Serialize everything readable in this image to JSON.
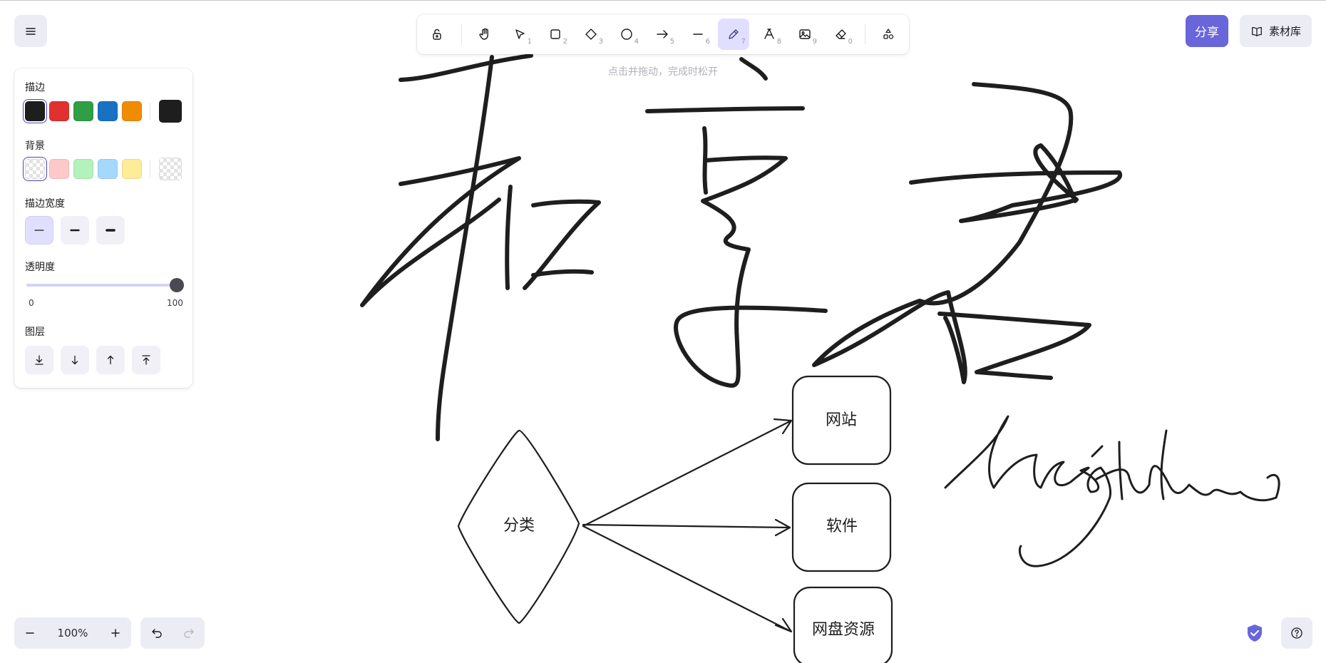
{
  "toolbar": {
    "tools": [
      {
        "name": "lock",
        "key": ""
      },
      {
        "name": "hand",
        "key": ""
      },
      {
        "name": "selection",
        "key": "1"
      },
      {
        "name": "rectangle",
        "key": "2"
      },
      {
        "name": "diamond",
        "key": "3"
      },
      {
        "name": "ellipse",
        "key": "4"
      },
      {
        "name": "arrow",
        "key": "5"
      },
      {
        "name": "line",
        "key": "6"
      },
      {
        "name": "freedraw",
        "key": "7",
        "active": true
      },
      {
        "name": "text",
        "key": "8"
      },
      {
        "name": "image",
        "key": "9"
      },
      {
        "name": "eraser",
        "key": "0"
      },
      {
        "name": "more-shapes",
        "key": ""
      }
    ],
    "hint": "点击并拖动，完成时松开"
  },
  "header": {
    "share_label": "分享",
    "library_label": "素材库"
  },
  "panel": {
    "stroke_title": "描边",
    "stroke_colors": [
      "#1e1e1e",
      "#e03131",
      "#2f9e44",
      "#1971c2",
      "#f08c00"
    ],
    "stroke_current": "#1e1e1e",
    "background_title": "背景",
    "background_colors": [
      "transparent",
      "#ffc9c9",
      "#b2f2bb",
      "#a5d8ff",
      "#ffec99"
    ],
    "background_current": "transparent",
    "stroke_width_title": "描边宽度",
    "stroke_width_selected": "thin",
    "opacity_title": "透明度",
    "opacity_min": "0",
    "opacity_max": "100",
    "opacity_value": 100,
    "layers_title": "图层"
  },
  "canvas": {
    "diamond_text": "分类",
    "boxes": [
      "网站",
      "软件",
      "网盘资源"
    ],
    "handwriting": [
      "和享君",
      "hxojshare"
    ]
  },
  "footer": {
    "zoom": "100%"
  },
  "colors": {
    "accent": "#6965db",
    "accent_light": "#e0dfff",
    "ui_gray": "#ececf4"
  }
}
